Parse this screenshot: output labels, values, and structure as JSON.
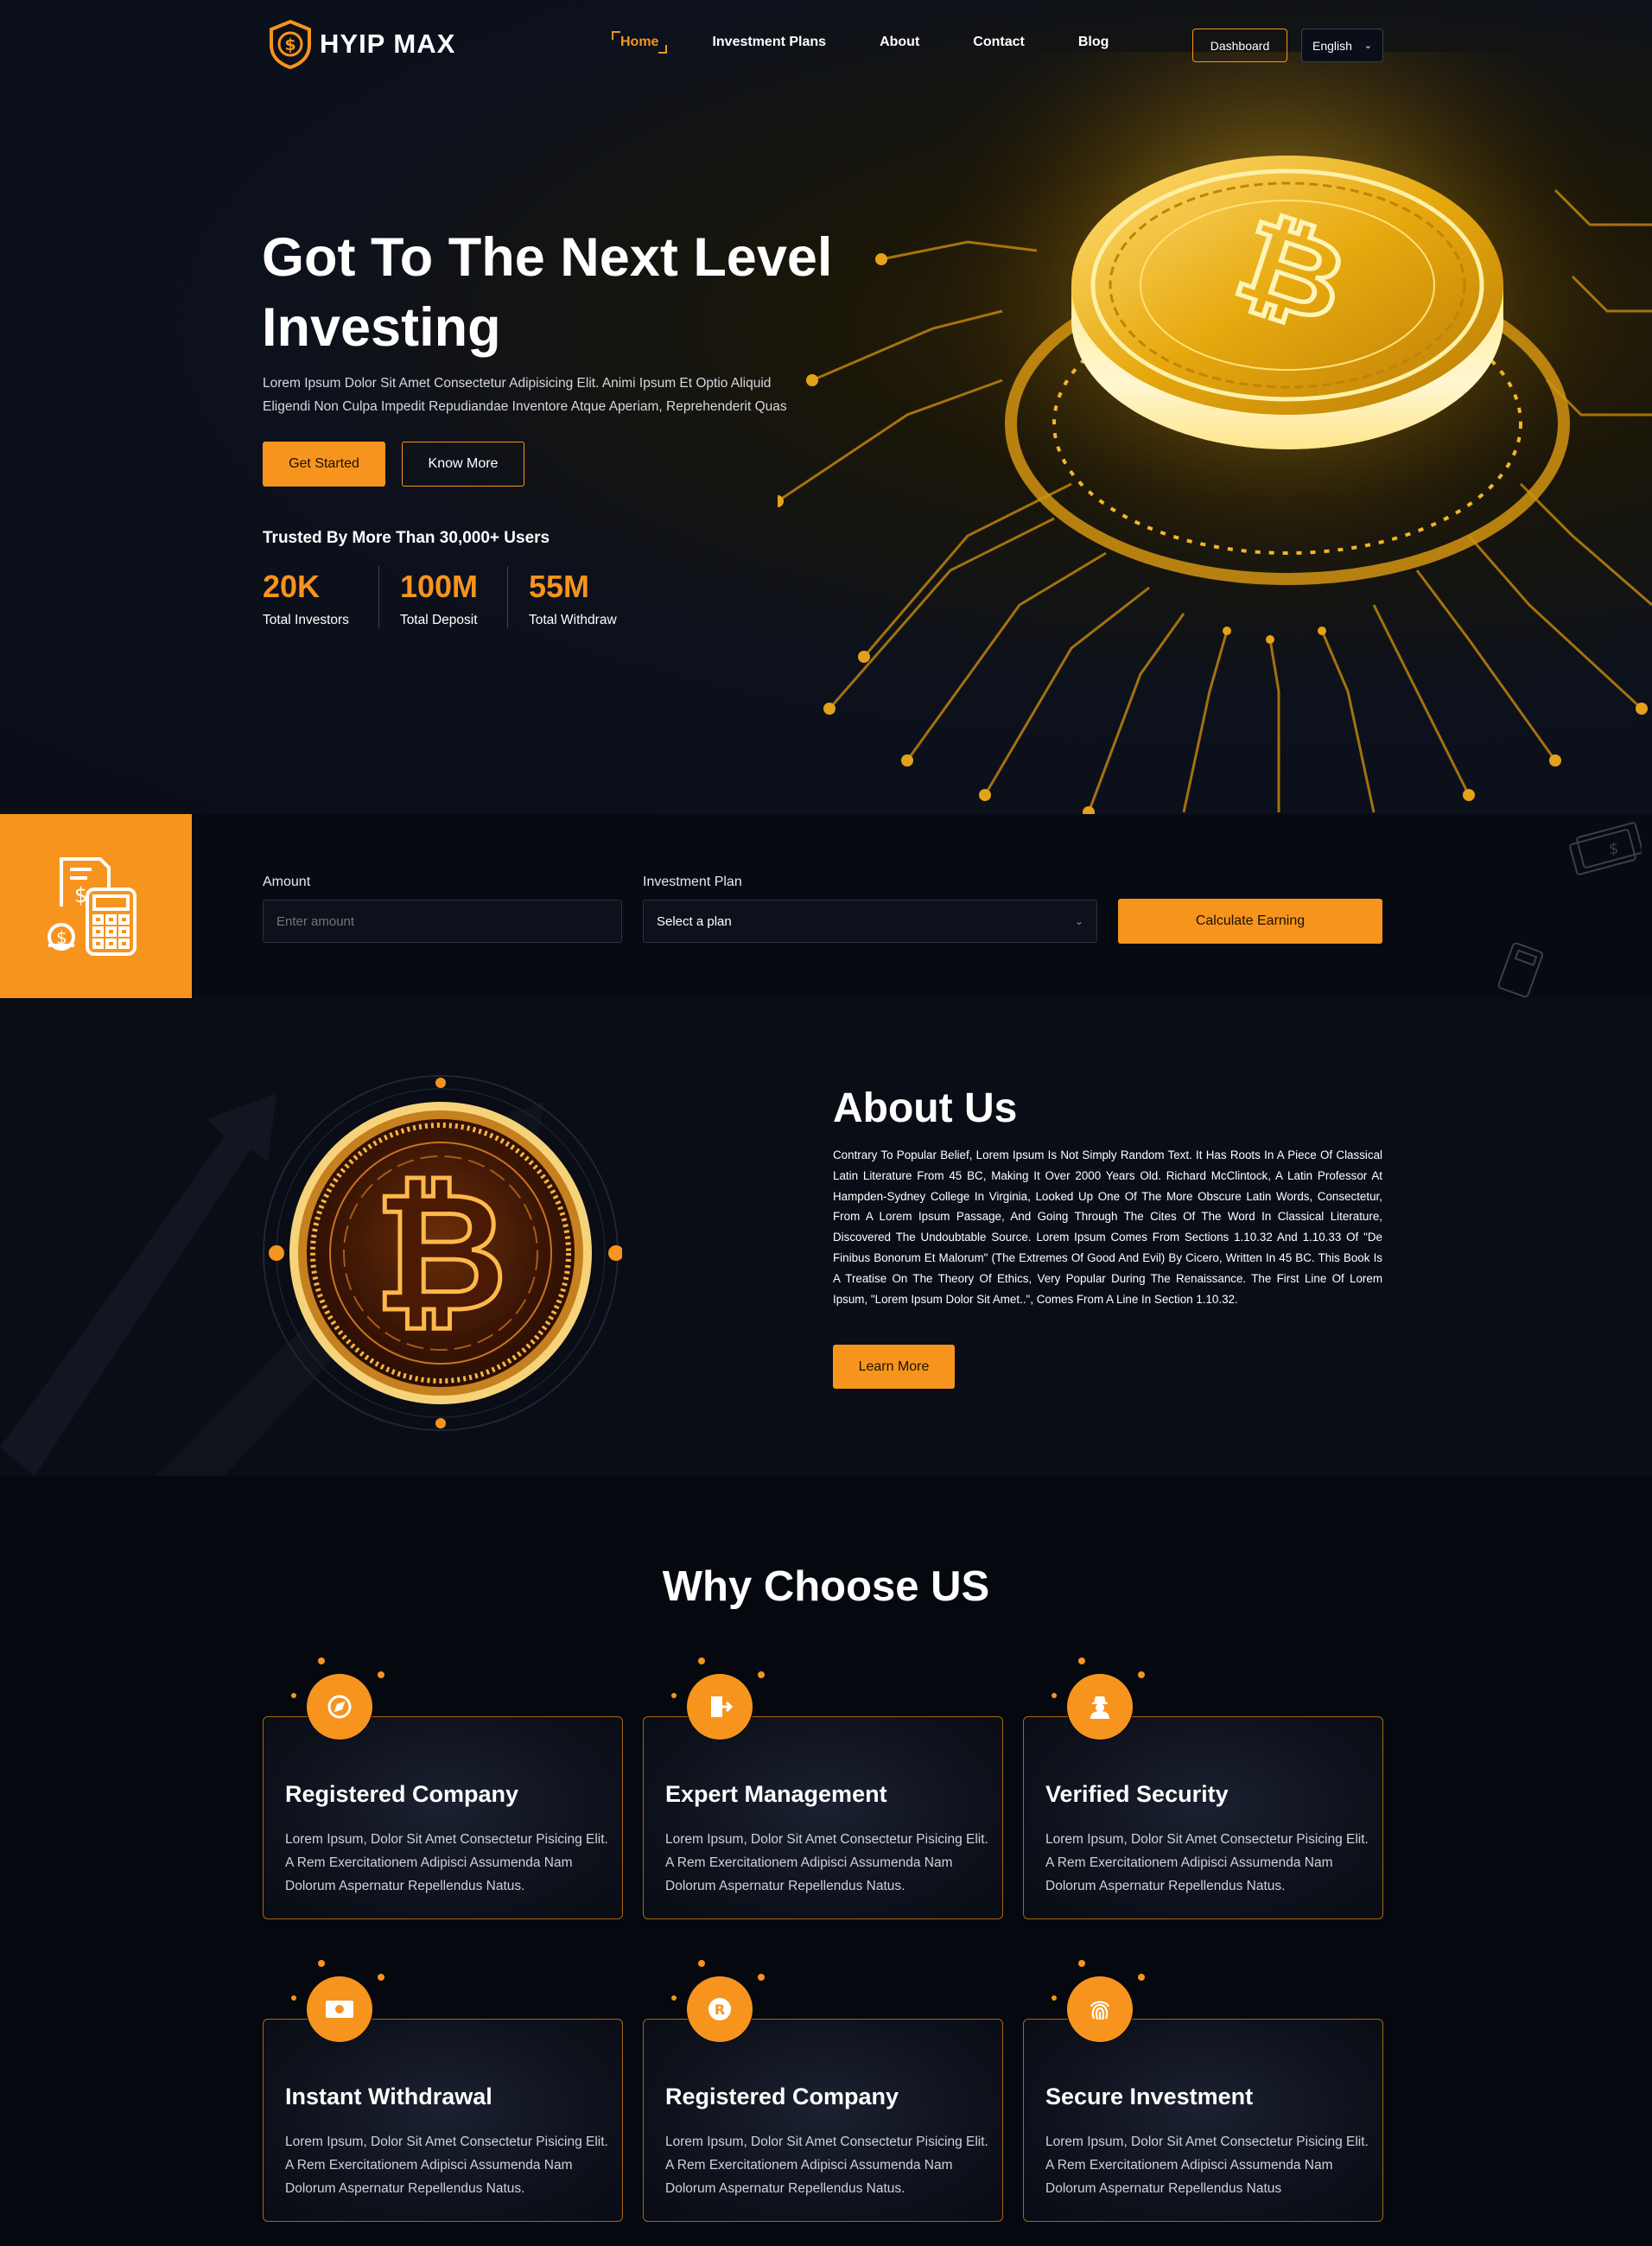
{
  "header": {
    "logo_text": "HYIP MAX",
    "nav": [
      "Home",
      "Investment Plans",
      "About",
      "Contact",
      "Blog"
    ],
    "active_nav": "Home",
    "dashboard_label": "Dashboard",
    "language": "English"
  },
  "hero": {
    "title_line1": "Got To The Next Level",
    "title_line2": "Investing",
    "description_line1": "Lorem Ipsum Dolor Sit Amet Consectetur Adipisicing Elit. Animi Ipsum Et Optio Aliquid",
    "description_line2": "Eligendi Non Culpa Impedit Repudiandae Inventore Atque Aperiam, Reprehenderit Quas",
    "get_started_label": "Get Started",
    "know_more_label": "Know More",
    "trusted_text": "Trusted By More Than 30,000+ Users",
    "stats": [
      {
        "value": "20K",
        "label": "Total Investors"
      },
      {
        "value": "100M",
        "label": "Total Deposit"
      },
      {
        "value": "55M",
        "label": "Total Withdraw"
      }
    ]
  },
  "calculator": {
    "amount_label": "Amount",
    "amount_placeholder": "Enter amount",
    "plan_label": "Investment Plan",
    "plan_value": "Select a plan",
    "calculate_label": "Calculate Earning"
  },
  "about": {
    "title": "About Us",
    "text": "Contrary To Popular Belief, Lorem Ipsum Is Not Simply Random Text. It Has Roots In A Piece Of Classical Latin Literature From 45 BC, Making It Over 2000 Years Old. Richard McClintock, A Latin Professor At Hampden-Sydney College In Virginia, Looked Up One Of The More Obscure Latin Words, Consectetur, From A Lorem Ipsum Passage, And Going Through The Cites Of The Word In Classical Literature, Discovered The Undoubtable Source. Lorem Ipsum Comes From Sections 1.10.32 And 1.10.33 Of \"De Finibus Bonorum Et Malorum\" (The Extremes Of Good And Evil) By Cicero, Written In 45 BC. This Book Is A Treatise On The Theory Of Ethics, Very Popular During The Renaissance. The First Line Of Lorem Ipsum, \"Lorem Ipsum Dolor Sit Amet..\", Comes From A Line In Section 1.10.32.",
    "learn_more_label": "Learn More"
  },
  "why": {
    "title": "Why Choose US",
    "cards": [
      {
        "title": "Registered Company",
        "icon": "compass-icon",
        "desc": "Lorem Ipsum, Dolor Sit Amet Consectetur Pisicing Elit. A Rem Exercitationem Adipisci Assumenda Nam Dolorum Aspernatur Repellendus Natus."
      },
      {
        "title": "Expert Management",
        "icon": "document-export-icon",
        "desc": "Lorem Ipsum, Dolor Sit Amet Consectetur Pisicing Elit. A Rem Exercitationem Adipisci Assumenda Nam Dolorum Aspernatur Repellendus Natus."
      },
      {
        "title": "Verified Security",
        "icon": "agent-icon",
        "desc": "Lorem Ipsum, Dolor Sit Amet Consectetur Pisicing Elit. A Rem Exercitationem Adipisci Assumenda Nam Dolorum Aspernatur Repellendus Natus."
      },
      {
        "title": "Instant Withdrawal",
        "icon": "money-bill-icon",
        "desc": "Lorem Ipsum, Dolor Sit Amet Consectetur Pisicing Elit. A Rem Exercitationem Adipisci Assumenda Nam Dolorum Aspernatur Repellendus Natus."
      },
      {
        "title": "Registered Company",
        "icon": "registered-icon",
        "desc": "Lorem Ipsum, Dolor Sit Amet Consectetur Pisicing Elit. A Rem Exercitationem Adipisci Assumenda Nam Dolorum Aspernatur Repellendus Natus."
      },
      {
        "title": "Secure Investment",
        "icon": "fingerprint-icon",
        "desc": "Lorem Ipsum, Dolor Sit Amet Consectetur Pisicing Elit. A Rem Exercitationem Adipisci Assumenda Nam Dolorum Aspernatur Repellendus Natus"
      }
    ]
  },
  "colors": {
    "accent": "#f7941d",
    "background": "#0a0d16",
    "card_border": "#a36717"
  }
}
